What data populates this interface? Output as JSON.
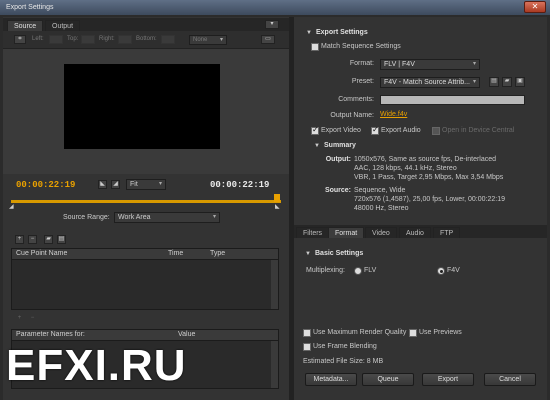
{
  "window": {
    "title": "Export Settings",
    "close_glyph": "✕"
  },
  "left": {
    "tabs": [
      "Source",
      "Output"
    ],
    "crop": {
      "labels": [
        "Left:",
        "Top:",
        "Right:",
        "Bottom:"
      ],
      "values": [
        "0",
        "0",
        "0",
        "0"
      ],
      "aspect": "None"
    },
    "time_left": "00:00:22:19",
    "time_right": "00:00:22:19",
    "fit_option": "Fit",
    "source_range_label": "Source Range:",
    "source_range_value": "Work Area",
    "cue_table": {
      "headers": [
        "Cue Point Name",
        "Time",
        "Type"
      ]
    },
    "param_table": {
      "headers": [
        "Parameter Names for:",
        "Value"
      ]
    },
    "watermark": "EFXI.RU"
  },
  "right": {
    "export_settings_title": "Export Settings",
    "match_sequence": "Match Sequence Settings",
    "format_label": "Format:",
    "format_value": "FLV | F4V",
    "preset_label": "Preset:",
    "preset_value": "F4V - Match Source Attrib...",
    "comments_label": "Comments:",
    "output_name_label": "Output Name:",
    "output_name_value": "Wide.f4v",
    "export_video": "Export Video",
    "export_audio": "Export Audio",
    "open_central": "Open in Device Central",
    "summary_title": "Summary",
    "summary": {
      "output_label": "Output:",
      "output_lines": [
        "1050x576, Same as source fps, De-interlaced",
        "AAC, 128 kbps, 44.1 kHz, Stereo",
        "VBR, 1 Pass, Target 2,95 Mbps, Max 3,54 Mbps"
      ],
      "source_label": "Source:",
      "source_lines": [
        "Sequence, Wide",
        "720x576 (1,4587), 25,00 fps, Lower, 00:00:22:19",
        "48000 Hz, Stereo"
      ]
    },
    "tabs": [
      "Filters",
      "Format",
      "Video",
      "Audio",
      "FTP"
    ],
    "basic_settings_title": "Basic Settings",
    "multiplexing_label": "Multiplexing:",
    "mux_options": [
      "FLV",
      "F4V"
    ],
    "max_render_quality": "Use Maximum Render Quality",
    "use_previews": "Use Previews",
    "frame_blending": "Use Frame Blending",
    "file_size": "Estimated File Size: 8 MB",
    "buttons": {
      "metadata": "Metadata...",
      "queue": "Queue",
      "export": "Export",
      "cancel": "Cancel"
    }
  },
  "colors": {
    "timecode_accent": "#e8a000",
    "background": "#333333"
  }
}
